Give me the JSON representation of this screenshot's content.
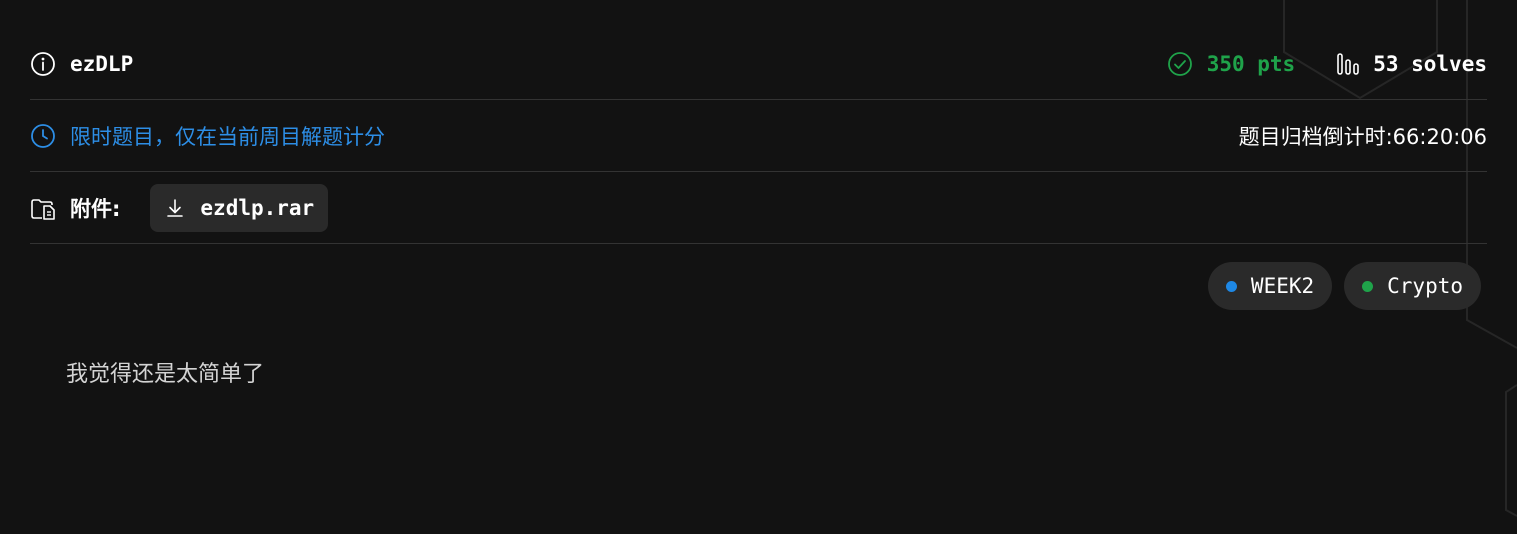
{
  "challenge": {
    "title": "ezDLP",
    "points": "350 pts",
    "solves": "53 solves",
    "limited_notice": "限时题目，仅在当前周目解题计分",
    "countdown": "题目归档倒计时:66:20:06",
    "attachment_label": "附件:",
    "attachment_file": "ezdlp.rar",
    "description": "我觉得还是太简单了"
  },
  "tags": [
    {
      "label": "WEEK2",
      "color": "#1e88e5"
    },
    {
      "label": "Crypto",
      "color": "#1fa34a"
    }
  ],
  "colors": {
    "background": "#121212",
    "points": "#1fa34a",
    "notice": "#2d8ee6",
    "divider": "#333333"
  },
  "icons": {
    "title": "info-icon",
    "points": "check-circle-icon",
    "solves": "bars-icon",
    "notice": "clock-icon",
    "attachment": "folder-file-icon",
    "download": "download-icon"
  }
}
